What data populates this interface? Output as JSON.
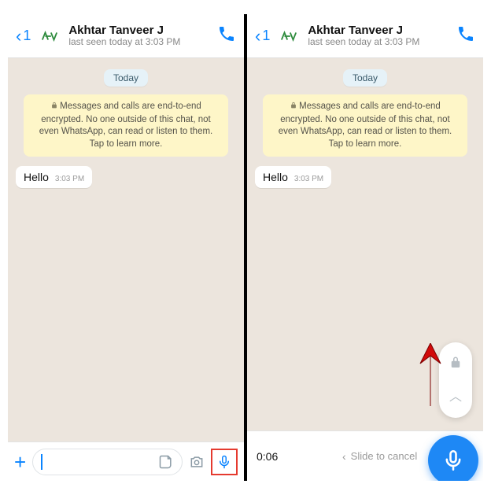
{
  "left": {
    "header": {
      "back_count": "1",
      "contact_name": "Akhtar Tanveer J",
      "last_seen": "last seen today at 3:03 PM"
    },
    "chat": {
      "date_label": "Today",
      "encryption_notice": "Messages and calls are end-to-end encrypted. No one outside of this chat, not even WhatsApp, can read or listen to them. Tap to learn more.",
      "messages": [
        {
          "text": "Hello",
          "time": "3:03 PM"
        }
      ]
    },
    "input": {
      "placeholder": ""
    }
  },
  "right": {
    "header": {
      "back_count": "1",
      "contact_name": "Akhtar Tanveer J",
      "last_seen": "last seen today at 3:03 PM"
    },
    "chat": {
      "date_label": "Today",
      "encryption_notice": "Messages and calls are end-to-end encrypted. No one outside of this chat, not even WhatsApp, can read or listen to them. Tap to learn more.",
      "messages": [
        {
          "text": "Hello",
          "time": "3:03 PM"
        }
      ]
    },
    "recording": {
      "elapsed": "0:06",
      "hint": "Slide to cancel"
    }
  }
}
